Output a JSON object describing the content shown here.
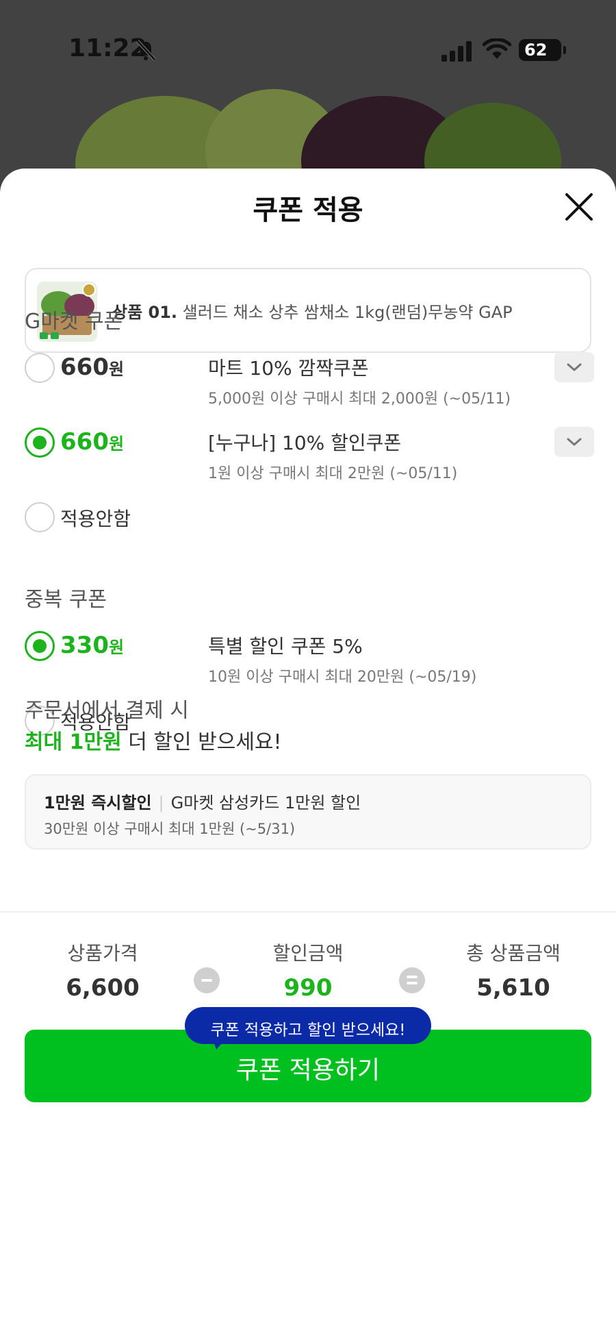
{
  "status_bar": {
    "time": "11:22",
    "battery": "62"
  },
  "sheet": {
    "title": "쿠폰 적용"
  },
  "product": {
    "prefix": "상품 01.",
    "name": "샐러드 채소 상추 쌈채소 1kg(랜덤)무농약 GAP"
  },
  "gmarket_coupons": {
    "title": "G마켓 쿠폰",
    "items": [
      {
        "amount": "660",
        "unit": "원",
        "title": "마트 10% 깜짝쿠폰",
        "desc": "5,000원 이상 구매시 최대 2,000원 (~05/11)",
        "selected": false
      },
      {
        "amount": "660",
        "unit": "원",
        "title": "[누구나] 10% 할인쿠폰",
        "desc": "1원 이상 구매시 최대 2만원 (~05/11)",
        "selected": true
      }
    ],
    "none_label": "적용안함"
  },
  "duplicate_coupons": {
    "title": "중복 쿠폰",
    "items": [
      {
        "amount": "330",
        "unit": "원",
        "title": "특별 할인 쿠폰 5%",
        "desc": "10원 이상 구매시 최대 20만원 (~05/19)",
        "selected": true
      }
    ],
    "none_label": "적용안함"
  },
  "promo": {
    "line1": "주문서에서 결제 시",
    "highlight": "최대 1만원",
    "line2_rest": " 더 할인 받으세요!",
    "card": {
      "badge": "1만원 즉시할인",
      "separator": "|",
      "title": "G마켓 삼성카드 1만원 할인",
      "desc": "30만원 이상 구매시 최대 1만원 (~5/31)"
    }
  },
  "summary": {
    "price_label": "상품가격",
    "price": "6,600",
    "discount_label": "할인금액",
    "discount": "990",
    "total_label": "총 상품금액",
    "total": "5,610"
  },
  "tooltip": "쿠폰 적용하고 할인 받으세요!",
  "cta_label": "쿠폰 적용하기",
  "colors": {
    "accent_green": "#1db31d",
    "cta_green": "#00c020",
    "tooltip_blue": "#0a2aa8"
  }
}
